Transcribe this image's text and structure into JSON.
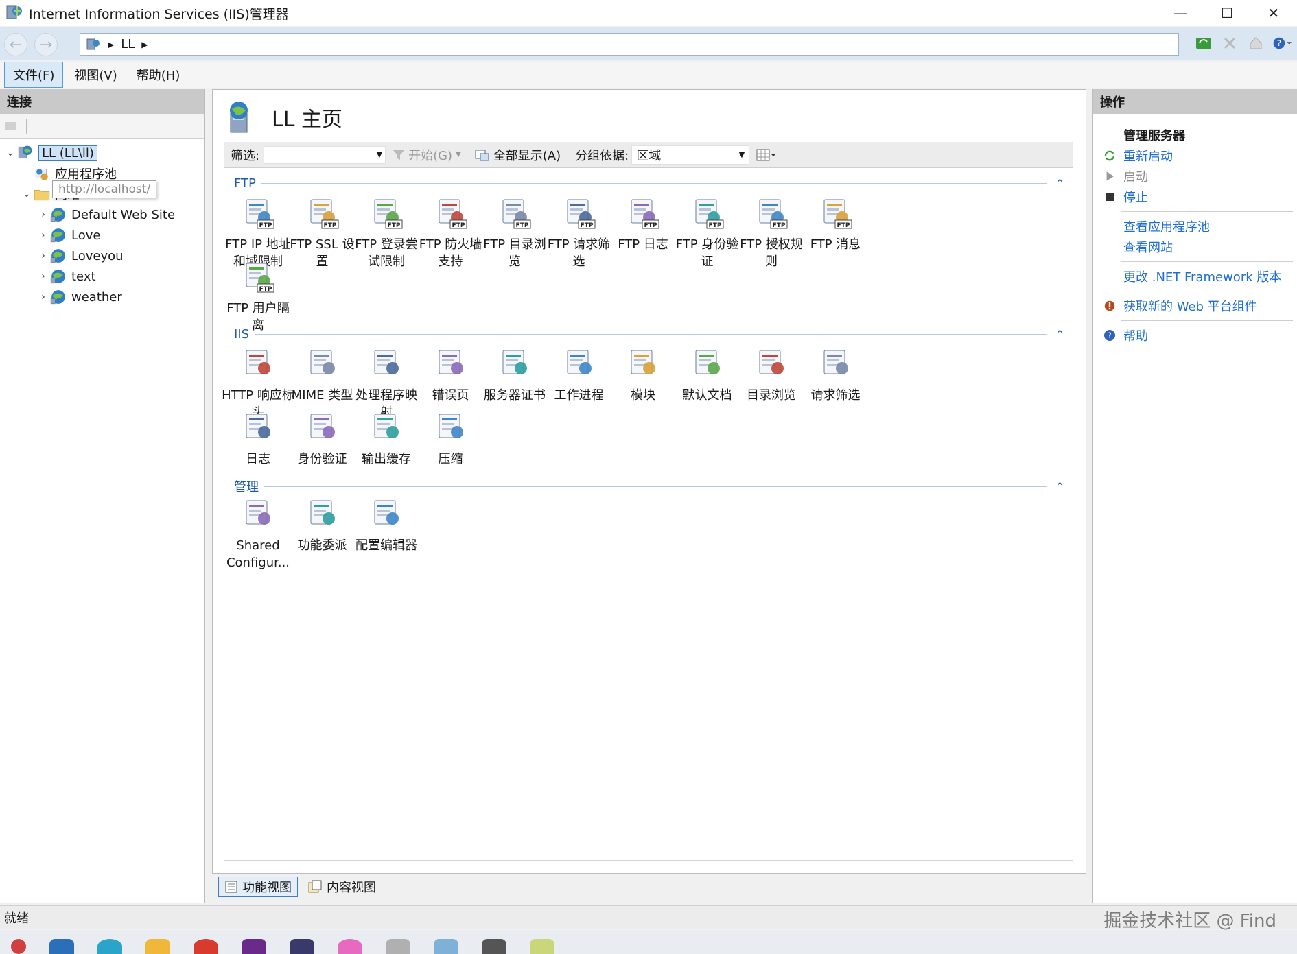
{
  "window": {
    "title": "Internet Information Services (IIS)管理器",
    "controls": {
      "minimize": "—",
      "maximize": "☐",
      "close": "✕"
    }
  },
  "address": {
    "crumb": "LL"
  },
  "menu": [
    "文件(F)",
    "视图(V)",
    "帮助(H)"
  ],
  "left": {
    "header": "连接",
    "tree": [
      {
        "label": "LL (LL\\ll)",
        "level": 0,
        "expander": "⌄",
        "icon": "server-icon",
        "selected": true
      },
      {
        "label": "应用程序池",
        "level": 1,
        "expander": "",
        "icon": "app-pool-icon"
      },
      {
        "label": "网站",
        "level": 1,
        "expander": "⌄",
        "icon": "sites-folder-icon"
      },
      {
        "label": "Default Web Site",
        "level": 2,
        "expander": "›",
        "icon": "globe-icon"
      },
      {
        "label": "Love",
        "level": 2,
        "expander": "›",
        "icon": "globe-icon"
      },
      {
        "label": "Loveyou",
        "level": 2,
        "expander": "›",
        "icon": "globe-icon"
      },
      {
        "label": "text",
        "level": 2,
        "expander": "›",
        "icon": "globe-icon"
      },
      {
        "label": "weather",
        "level": 2,
        "expander": "›",
        "icon": "globe-icon"
      }
    ],
    "tooltip": "http://localhost/"
  },
  "center": {
    "title": "LL 主页",
    "filter": {
      "label": "筛选:",
      "start": "开始(G)",
      "show_all": "全部显示(A)",
      "group_label": "分组依据:",
      "group_value": "区域"
    },
    "sections": [
      {
        "name": "FTP",
        "items": [
          [
            "FTP IP 地址",
            "和域限制"
          ],
          [
            "FTP SSL 设",
            "置"
          ],
          [
            "FTP 登录尝",
            "试限制"
          ],
          [
            "FTP 防火墙",
            "支持"
          ],
          [
            "FTP 目录浏",
            "览"
          ],
          [
            "FTP 请求筛",
            "选"
          ],
          [
            "FTP 日志"
          ],
          [
            "FTP 身份验",
            "证"
          ],
          [
            "FTP 授权规",
            "则"
          ],
          [
            "FTP 消息"
          ],
          [
            "FTP 用户隔",
            "离"
          ]
        ]
      },
      {
        "name": "IIS",
        "items": [
          [
            "HTTP 响应标",
            "头"
          ],
          [
            "MIME 类型"
          ],
          [
            "处理程序映",
            "射"
          ],
          [
            "错误页"
          ],
          [
            "服务器证书"
          ],
          [
            "工作进程"
          ],
          [
            "模块"
          ],
          [
            "默认文档"
          ],
          [
            "目录浏览"
          ],
          [
            "请求筛选"
          ],
          [
            "日志"
          ],
          [
            "身份验证"
          ],
          [
            "输出缓存"
          ],
          [
            "压缩"
          ]
        ]
      },
      {
        "name": "管理",
        "items": [
          [
            "Shared",
            "Configur..."
          ],
          [
            "功能委派"
          ],
          [
            "配置编辑器"
          ]
        ]
      }
    ],
    "tabs": [
      "功能视图",
      "内容视图"
    ]
  },
  "right": {
    "header": "操作",
    "group_title": "管理服务器",
    "actions": [
      {
        "label": "重新启动",
        "icon": "restart-icon",
        "disabled": false
      },
      {
        "label": "启动",
        "icon": "start-icon",
        "disabled": true
      },
      {
        "label": "停止",
        "icon": "stop-icon",
        "disabled": false
      },
      {
        "sep": true
      },
      {
        "label": "查看应用程序池",
        "icon": "",
        "disabled": false
      },
      {
        "label": "查看网站",
        "icon": "",
        "disabled": false
      },
      {
        "sep": true
      },
      {
        "label": "更改 .NET Framework 版本",
        "icon": "",
        "disabled": false
      },
      {
        "sep": true
      },
      {
        "label": "获取新的 Web 平台组件",
        "icon": "web-platform-icon",
        "disabled": false
      },
      {
        "sep": true
      },
      {
        "label": "帮助",
        "icon": "help-icon",
        "disabled": false
      }
    ]
  },
  "status": {
    "text": "就绪"
  },
  "watermark": "掘金技术社区 @ Find",
  "colors": {
    "link": "#1e6fd0",
    "section": "#1e5aa8",
    "accent": "#3d7ec9"
  }
}
